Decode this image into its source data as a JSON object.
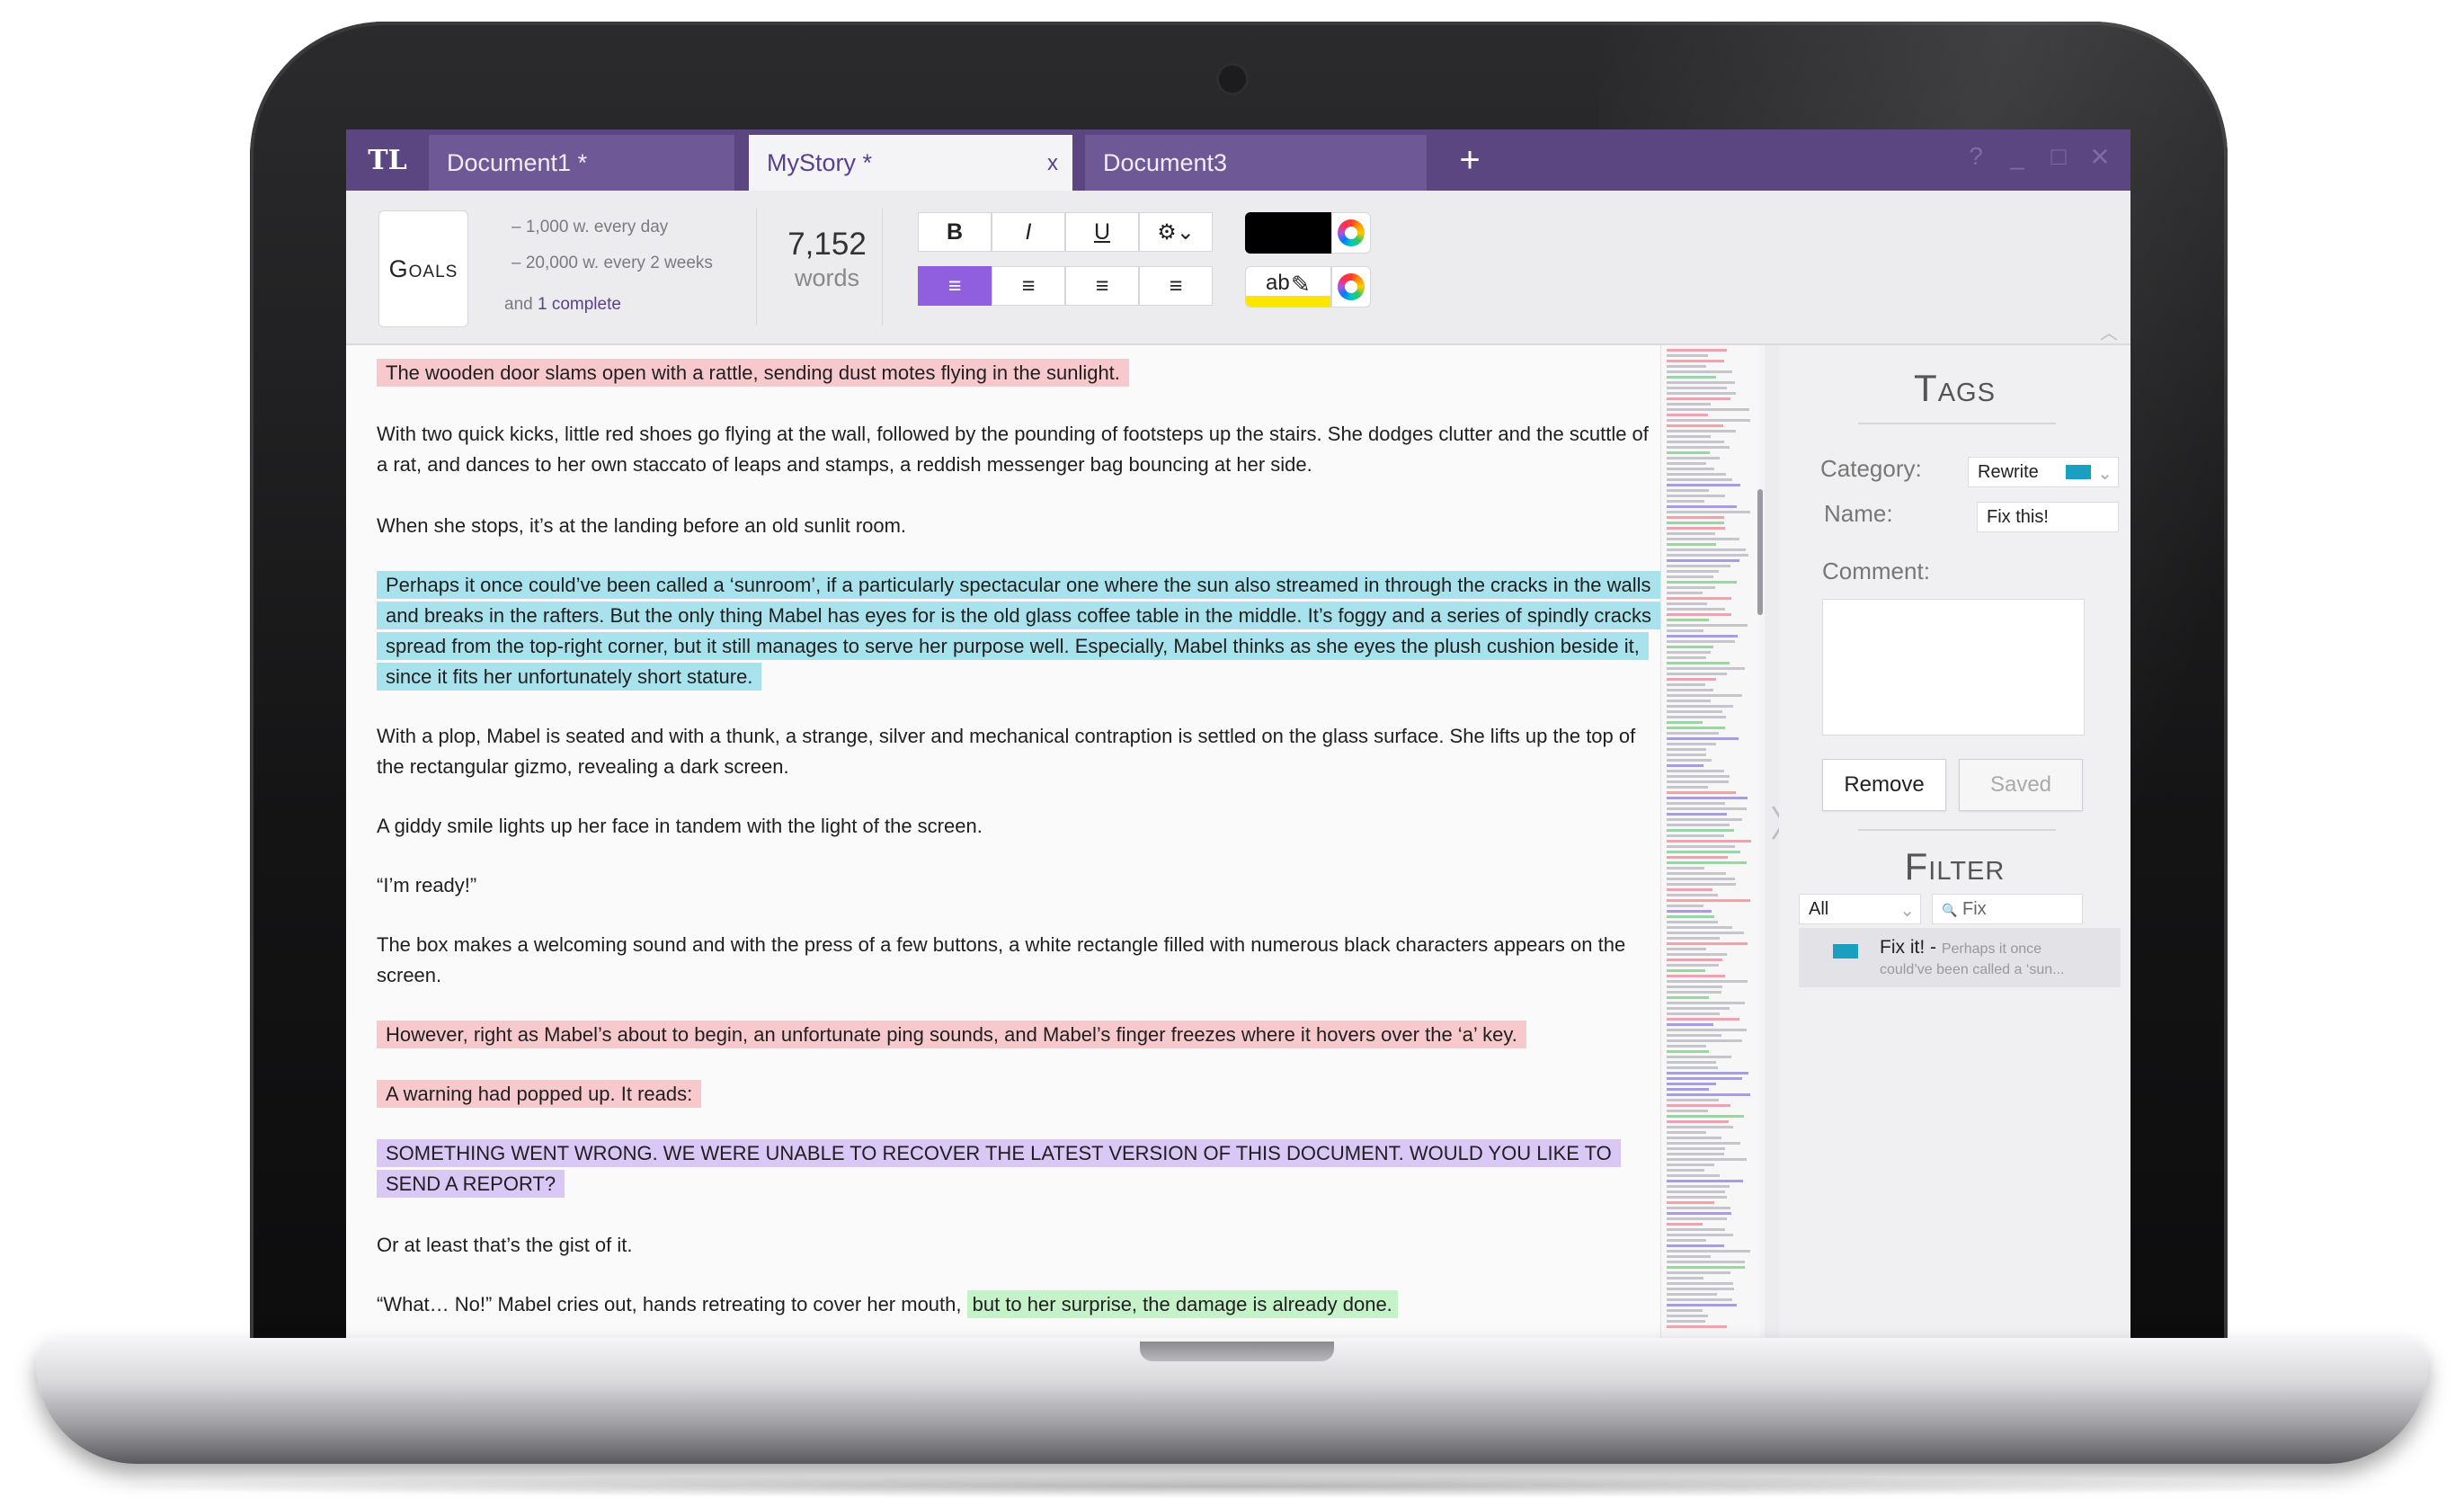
{
  "app": {
    "logo": "TL"
  },
  "tabs": [
    {
      "label": "Document1 *"
    },
    {
      "label": "MyStory *",
      "close": "x"
    },
    {
      "label": "Document3"
    }
  ],
  "add_tab": "+",
  "window_controls": {
    "help": "?",
    "minimize": "_",
    "maximize": "□",
    "close": "✕"
  },
  "goals": {
    "button": "Goals",
    "items": [
      "– 1,000 w. every day",
      "– 20,000 w. every 2 weeks"
    ],
    "complete_prefix": "and ",
    "complete_count": "1 complete"
  },
  "word_count": {
    "value": "7,152",
    "label": "words"
  },
  "format": {
    "bold": "B",
    "italic": "I",
    "underline": "U",
    "settings": "⚙⌄"
  },
  "align": {
    "left": "≡",
    "center": "≡",
    "right": "≡",
    "justify": "≡"
  },
  "colors": {
    "text_color": "#000000",
    "highlight_color": "#ffe600",
    "highlight_sample": "ab",
    "accent": "#5c4681",
    "tag_rewrite": "#1a9fc0"
  },
  "document": {
    "paragraphs": [
      {
        "style": "pink",
        "text": "The wooden door slams open with a rattle, sending dust motes flying in the sunlight."
      },
      {
        "style": "plain",
        "text": "With two quick kicks, little red shoes go flying at the wall, followed by the pounding of footsteps up the stairs. She dodges clutter and the scuttle of a rat, and dances to her own staccato of leaps and stamps, a reddish messenger bag bouncing at her side."
      },
      {
        "style": "plain",
        "text": "When she stops, it’s at the landing before an old sunlit room."
      },
      {
        "style": "blue",
        "text": "Perhaps it once could’ve been called a ‘sunroom’, if a particularly spectacular one where the sun also streamed in through the cracks in the walls and breaks in the rafters. But the only thing Mabel has eyes for is the old glass coffee table in the middle. It’s foggy and a series of spindly cracks spread from the top-right corner, but it still manages to serve her purpose well. Especially, Mabel thinks as she eyes the plush cushion beside it, since it fits her unfortunately short stature."
      },
      {
        "style": "plain",
        "text": "With a plop, Mabel is seated and with a thunk, a strange, silver and mechanical contraption is settled on the glass surface. She lifts up the top of the rectangular gizmo, revealing a dark screen."
      },
      {
        "style": "plain",
        "text": "A giddy smile lights up her face in tandem with the light of the screen."
      },
      {
        "style": "plain",
        "text": "“I’m ready!”"
      },
      {
        "style": "plain",
        "text": "The box makes a welcoming sound and with the press of a few buttons, a white rectangle filled with numerous black characters appears on the screen."
      },
      {
        "style": "pink",
        "text": "However, right as Mabel’s about to begin, an unfortunate ping sounds, and Mabel’s finger freezes where it hovers over the ‘a’ key."
      },
      {
        "style": "pink",
        "text": "A warning had popped up. It reads:"
      },
      {
        "style": "purple",
        "text": "SOMETHING WENT WRONG. WE WERE UNABLE TO RECOVER THE LATEST VERSION OF THIS DOCUMENT. WOULD YOU LIKE TO SEND A REPORT?"
      },
      {
        "style": "plain",
        "text": "Or at least that’s the gist of it."
      },
      {
        "style": "mixed",
        "text": "“What… No!” Mabel cries out, hands retreating to cover her mouth, ",
        "highlight": "but to her surprise, the damage is already done."
      }
    ]
  },
  "tags_panel": {
    "title": "Tags",
    "category_label": "Category:",
    "category_value": "Rewrite",
    "name_label": "Name:",
    "name_value": "Fix this!",
    "comment_label": "Comment:",
    "comment_value": "",
    "remove_button": "Remove",
    "saved_button": "Saved"
  },
  "filter_panel": {
    "title": "Filter",
    "select_value": "All",
    "search_value": "Fix",
    "search_icon": "🔍",
    "results": [
      {
        "name": "Fix it! -",
        "excerpt": "Perhaps it once",
        "excerpt2": "could’ve been called a ‘sun..."
      }
    ]
  }
}
